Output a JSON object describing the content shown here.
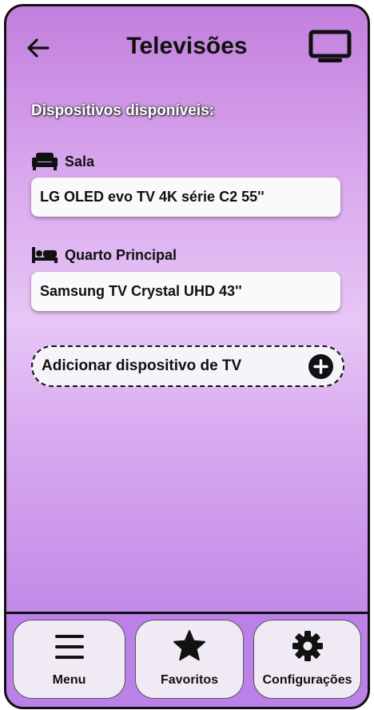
{
  "header": {
    "title": "Televisões",
    "back_icon": "arrow-left-icon",
    "tv_icon": "tv-icon"
  },
  "main": {
    "section_title": "Dispositivos disponíveis:",
    "rooms": [
      {
        "label": "Sala",
        "icon": "sofa-icon",
        "device": "LG OLED evo TV 4K série C2 55''"
      },
      {
        "label": "Quarto Principal",
        "icon": "bed-icon",
        "device": "Samsung TV Crystal UHD 43''"
      }
    ],
    "add_device_label": "Adicionar dispositivo de TV",
    "add_icon": "plus-circle-icon"
  },
  "nav": {
    "items": [
      {
        "label": "Menu",
        "icon": "hamburger-menu-icon"
      },
      {
        "label": "Favoritos",
        "icon": "star-icon"
      },
      {
        "label": "Configurações",
        "icon": "gear-icon"
      }
    ]
  },
  "colors": {
    "gradient_top": "#c27fdd",
    "gradient_mid": "#e7c6f6",
    "gradient_bottom": "#b779e3",
    "nav_bar": "#bb81e8",
    "card": "#faf9fb"
  }
}
